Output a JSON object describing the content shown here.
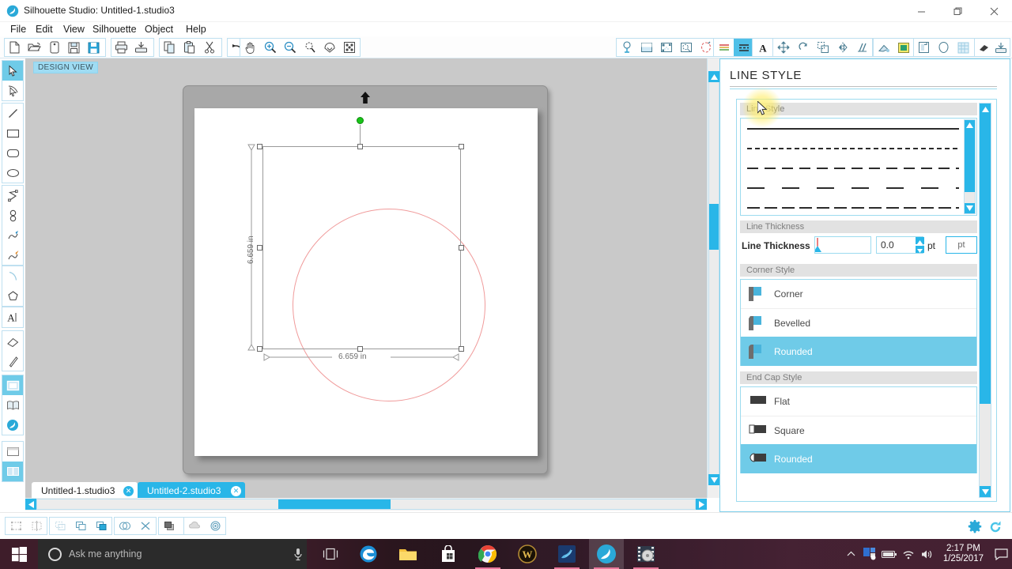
{
  "window": {
    "title": "Silhouette Studio: Untitled-1.studio3",
    "logo_icon": "silhouette-logo-icon",
    "minimize_icon": "minimize-icon",
    "maximize_icon": "maximize-icon",
    "close_icon": "close-icon"
  },
  "menu": {
    "items": [
      {
        "label": "File"
      },
      {
        "label": "Edit"
      },
      {
        "label": "View"
      },
      {
        "label": "Silhouette"
      },
      {
        "label": "Object"
      },
      {
        "label": "Help"
      }
    ]
  },
  "toolbar": {
    "groups": [
      {
        "name": "file-group",
        "buttons": [
          {
            "icon": "new-document-icon",
            "title": "New"
          },
          {
            "icon": "open-folder-icon",
            "title": "Open"
          },
          {
            "icon": "open-recent-icon",
            "title": "Open Recent"
          },
          {
            "icon": "save-icon",
            "title": "Save"
          },
          {
            "icon": "save-as-icon",
            "title": "Save As"
          }
        ]
      },
      {
        "name": "print-group",
        "buttons": [
          {
            "icon": "print-icon",
            "title": "Print"
          },
          {
            "icon": "send-to-silhouette-icon",
            "title": "Send to Silhouette"
          }
        ]
      },
      {
        "name": "clipboard-group",
        "buttons": [
          {
            "icon": "copy-icon",
            "title": "Copy"
          },
          {
            "icon": "paste-icon",
            "title": "Paste"
          },
          {
            "icon": "cut-scissors-icon",
            "title": "Cut"
          }
        ]
      },
      {
        "name": "history-group",
        "buttons": [
          {
            "icon": "undo-icon",
            "title": "Undo"
          },
          {
            "icon": "redo-icon",
            "title": "Redo"
          }
        ]
      },
      {
        "name": "view-group",
        "buttons": [
          {
            "icon": "pan-hand-icon",
            "title": "Pan"
          },
          {
            "icon": "zoom-in-icon",
            "title": "Zoom In"
          },
          {
            "icon": "zoom-out-icon",
            "title": "Zoom Out"
          },
          {
            "icon": "zoom-selection-icon",
            "title": "Zoom to Selection"
          },
          {
            "icon": "fit-to-page-icon",
            "title": "Fit to Page"
          },
          {
            "icon": "fit-to-window-icon",
            "title": "Fit to Window"
          }
        ]
      },
      {
        "name": "panels-group-a",
        "buttons": [
          {
            "icon": "cut-settings-icon",
            "title": "Cut Settings"
          },
          {
            "icon": "page-setup-icon",
            "title": "Page Setup"
          },
          {
            "icon": "registration-marks-icon",
            "title": "Registration Marks"
          },
          {
            "icon": "print-bleed-icon",
            "title": "Print Bleed"
          },
          {
            "icon": "trace-icon",
            "title": "Trace"
          }
        ]
      },
      {
        "name": "style-group",
        "buttons": [
          {
            "icon": "line-color-icon",
            "title": "Line Color",
            "state": "off"
          },
          {
            "icon": "line-style-icon",
            "title": "Line Style",
            "state": "on"
          }
        ]
      },
      {
        "name": "text-group",
        "buttons": [
          {
            "icon": "text-style-icon",
            "title": "Text Style"
          }
        ]
      },
      {
        "name": "transform-group",
        "buttons": [
          {
            "icon": "move-icon",
            "title": "Move"
          },
          {
            "icon": "rotate-icon",
            "title": "Rotate"
          },
          {
            "icon": "scale-icon",
            "title": "Scale"
          },
          {
            "icon": "mirror-icon",
            "title": "Mirror"
          },
          {
            "icon": "shear-icon",
            "title": "Shear"
          }
        ]
      },
      {
        "name": "fill-group",
        "buttons": [
          {
            "icon": "fill-color-icon",
            "title": "Fill Color"
          },
          {
            "icon": "fill-gradient-icon",
            "title": "Gradient Fill"
          }
        ]
      },
      {
        "name": "library-group",
        "buttons": [
          {
            "icon": "modify-icon",
            "title": "Modify"
          },
          {
            "icon": "offset-icon",
            "title": "Offset"
          },
          {
            "icon": "grid-icon",
            "title": "Grid"
          }
        ]
      },
      {
        "name": "misc-group",
        "buttons": [
          {
            "icon": "eraser-icon",
            "title": "Eraser"
          },
          {
            "icon": "send-icon",
            "title": "Send"
          }
        ]
      }
    ]
  },
  "left_tools": {
    "groups": [
      {
        "name": "select-group",
        "buttons": [
          {
            "icon": "select-arrow-icon",
            "title": "Select",
            "state": "on"
          },
          {
            "icon": "edit-points-icon",
            "title": "Edit Points",
            "state": "off"
          }
        ]
      },
      {
        "name": "shape-group",
        "buttons": [
          {
            "icon": "line-tool-icon",
            "title": "Draw a Line"
          },
          {
            "icon": "rectangle-tool-icon",
            "title": "Draw a Rectangle"
          },
          {
            "icon": "rounded-rectangle-tool-icon",
            "title": "Draw a Rounded Rectangle"
          },
          {
            "icon": "ellipse-tool-icon",
            "title": "Draw an Ellipse"
          }
        ]
      },
      {
        "name": "draw-group",
        "buttons": [
          {
            "icon": "polygon-tool-icon",
            "title": "Draw a Polygon"
          },
          {
            "icon": "curve-tool-icon",
            "title": "Draw a Curve Shape"
          },
          {
            "icon": "freehand-tool-icon",
            "title": "Draw Freehand"
          },
          {
            "icon": "smooth-freehand-tool-icon",
            "title": "Draw Smooth Freehand"
          }
        ]
      },
      {
        "name": "arc-group",
        "buttons": [
          {
            "icon": "arc-tool-icon",
            "title": "Draw an Arc"
          },
          {
            "icon": "regular-polygon-tool-icon",
            "title": "Draw a Regular Polygon"
          }
        ]
      },
      {
        "name": "text-group",
        "buttons": [
          {
            "icon": "text-tool-icon",
            "title": "Draw a Text Object"
          }
        ]
      },
      {
        "name": "erase-group",
        "buttons": [
          {
            "icon": "eraser-tool-icon",
            "title": "Eraser"
          },
          {
            "icon": "knife-tool-icon",
            "title": "Knife"
          }
        ]
      },
      {
        "name": "library-group",
        "buttons": [
          {
            "icon": "design-view-icon",
            "title": "Design Page",
            "state": "on"
          },
          {
            "icon": "library-book-icon",
            "title": "My Library",
            "state": "off"
          },
          {
            "icon": "store-icon",
            "title": "Silhouette Design Store",
            "state": "off"
          }
        ]
      },
      {
        "name": "layout-group",
        "buttons": [
          {
            "icon": "single-view-icon",
            "title": "Single View"
          },
          {
            "icon": "split-view-icon",
            "title": "Split View",
            "state": "on"
          }
        ]
      }
    ]
  },
  "canvas": {
    "design_view_label": "DESIGN VIEW",
    "mat_arrow_icon": "mat-feed-arrow-icon",
    "selection": {
      "rotation_handle_icon": "rotation-handle-icon",
      "width_label": "6.659 in",
      "height_label": "6.659 in",
      "shape": "circle",
      "stroke_color": "#f09b9b"
    },
    "collapse_panel_icon": "collapse-right-panel-icon",
    "scroll_up_icon": "scroll-up-icon",
    "scroll_down_icon": "scroll-down-icon",
    "scroll_left_icon": "scroll-left-icon",
    "scroll_right_icon": "scroll-right-icon"
  },
  "document_tabs": [
    {
      "label": "Untitled-1.studio3",
      "active": true,
      "close_icon": "close-tab-icon"
    },
    {
      "label": "Untitled-2.studio3",
      "active": false,
      "close_icon": "close-tab-icon"
    }
  ],
  "statusbar": {
    "groups": [
      {
        "name": "group-group",
        "buttons": [
          {
            "icon": "group-icon",
            "title": "Group"
          },
          {
            "icon": "ungroup-icon",
            "title": "Ungroup"
          }
        ]
      },
      {
        "name": "compound-group",
        "buttons": [
          {
            "icon": "make-compound-path-icon",
            "title": "Make Compound Path"
          },
          {
            "icon": "release-compound-path-icon",
            "title": "Release Compound Path"
          },
          {
            "icon": "weld-icon",
            "title": "Weld"
          }
        ]
      },
      {
        "name": "boolean-group",
        "buttons": [
          {
            "icon": "merge-icon",
            "title": "Merge"
          },
          {
            "icon": "detach-icon",
            "title": "Detach Lines"
          }
        ]
      },
      {
        "name": "arrange-group",
        "buttons": [
          {
            "icon": "bring-to-front-icon",
            "title": "Bring to Front"
          },
          {
            "icon": "send-to-back-icon",
            "title": "Send to Back"
          }
        ]
      },
      {
        "name": "effects-group",
        "buttons": [
          {
            "icon": "shadow-icon",
            "title": "Shadow"
          },
          {
            "icon": "offset-rings-icon",
            "title": "Offset"
          }
        ]
      }
    ],
    "right_buttons": [
      {
        "icon": "settings-gear-icon",
        "title": "Preferences"
      },
      {
        "icon": "sync-refresh-icon",
        "title": "Sync"
      }
    ]
  },
  "line_style_panel": {
    "title": "LINE STYLE",
    "sections": {
      "line_style": {
        "header": "Line Style",
        "options": [
          {
            "name": "solid",
            "dash": "none"
          },
          {
            "name": "dash-fine",
            "dash": "6,4"
          },
          {
            "name": "dash-medium",
            "dash": "14,8"
          },
          {
            "name": "dash-long-gap",
            "dash": "22,22"
          },
          {
            "name": "dash-short",
            "dash": "16,6"
          }
        ]
      },
      "line_thickness": {
        "header": "Line Thickness",
        "label": "Line Thickness",
        "value": "0.0",
        "unit": "pt",
        "unit_button": "pt",
        "spinner_up_icon": "spinner-up-icon",
        "spinner_down_icon": "spinner-down-icon",
        "slider_icon": "slider-handle-icon"
      },
      "corner_style": {
        "header": "Corner Style",
        "options": [
          {
            "label": "Corner",
            "icon": "corner-sharp-icon",
            "selected": false
          },
          {
            "label": "Bevelled",
            "icon": "corner-bevelled-icon",
            "selected": false
          },
          {
            "label": "Rounded",
            "icon": "corner-rounded-icon",
            "selected": true
          }
        ]
      },
      "end_cap_style": {
        "header": "End Cap Style",
        "options": [
          {
            "label": "Flat",
            "icon": "cap-flat-icon",
            "selected": false
          },
          {
            "label": "Square",
            "icon": "cap-square-icon",
            "selected": false
          },
          {
            "label": "Rounded",
            "icon": "cap-rounded-icon",
            "selected": true
          }
        ]
      }
    }
  },
  "taskbar": {
    "start_icon": "windows-start-icon",
    "search": {
      "placeholder": "Ask me anything",
      "cortana_icon": "cortana-circle-icon"
    },
    "mic_icon": "microphone-icon",
    "task_view_icon": "task-view-icon",
    "apps": [
      {
        "name": "edge",
        "icon": "edge-icon",
        "running": false,
        "active": false
      },
      {
        "name": "file-explorer",
        "icon": "folder-icon",
        "running": false,
        "active": false
      },
      {
        "name": "microsoft-store",
        "icon": "store-bag-icon",
        "running": false,
        "active": false
      },
      {
        "name": "chrome",
        "icon": "chrome-icon",
        "running": true,
        "active": false
      },
      {
        "name": "world-of-warcraft",
        "icon": "wow-icon",
        "running": false,
        "active": false
      },
      {
        "name": "blue-app",
        "icon": "blue-swirl-icon",
        "running": true,
        "active": false
      },
      {
        "name": "silhouette-studio",
        "icon": "silhouette-icon",
        "running": true,
        "active": true
      },
      {
        "name": "media-app",
        "icon": "media-reel-icon",
        "running": true,
        "active": false
      }
    ],
    "tray": {
      "chevron_icon": "show-hidden-icons-icon",
      "icons": [
        {
          "name": "onedrive-blue-icon"
        },
        {
          "name": "battery-icon"
        },
        {
          "name": "wifi-icon"
        },
        {
          "name": "volume-icon"
        }
      ],
      "time": "2:17 PM",
      "date": "1/25/2017",
      "notifications_icon": "action-center-icon"
    }
  },
  "colors": {
    "accent": "#29b6e8",
    "accent_light": "#6fcbe8",
    "panel_border": "#9ddbef",
    "canvas_bg": "#c9c9c9",
    "shape_stroke": "#f09b9b"
  }
}
